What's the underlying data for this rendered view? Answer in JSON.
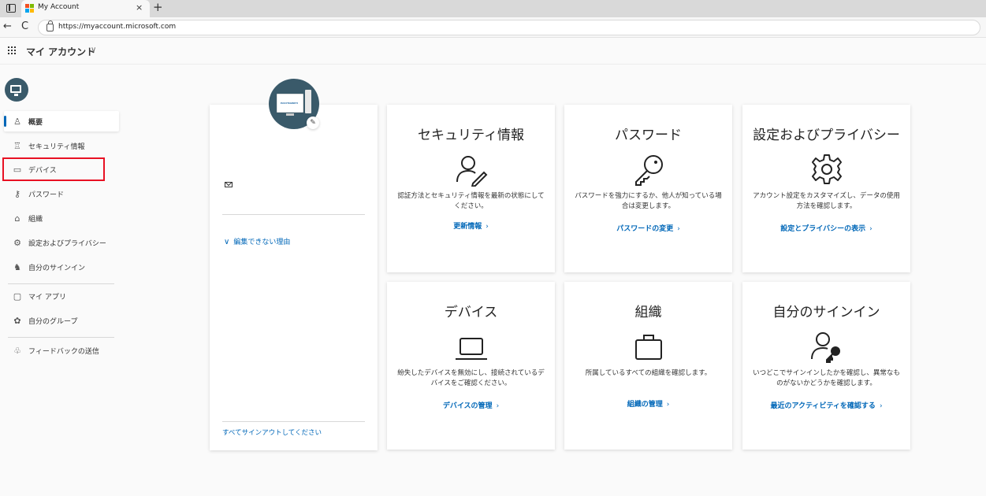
{
  "browser": {
    "tab_title": "My Account",
    "tab_close": "×",
    "new_tab": "+",
    "url": "https://myaccount.microsoft.com",
    "back": "←",
    "reload": "C"
  },
  "header": {
    "app_title": "マイ アカウント",
    "caret": "∨"
  },
  "sidebar": {
    "items": [
      {
        "label": "概要",
        "icon": "person-icon",
        "glyph": "♙"
      },
      {
        "label": "セキュリティ情報",
        "icon": "security-info-icon",
        "glyph": "♖"
      },
      {
        "label": "デバイス",
        "icon": "laptop-icon",
        "glyph": "▭"
      },
      {
        "label": "パスワード",
        "icon": "key-icon",
        "glyph": "⚷"
      },
      {
        "label": "組織",
        "icon": "briefcase-icon",
        "glyph": "⌂"
      },
      {
        "label": "設定およびプライバシー",
        "icon": "gear-icon",
        "glyph": "⚙"
      },
      {
        "label": "自分のサインイン",
        "icon": "sign-in-icon",
        "glyph": "♞"
      },
      {
        "label": "マイ アプリ",
        "icon": "apps-icon",
        "glyph": "▢"
      },
      {
        "label": "自分のグループ",
        "icon": "groups-icon",
        "glyph": "✿"
      },
      {
        "label": "フィードバックの送信",
        "icon": "feedback-icon",
        "glyph": "♧"
      }
    ],
    "active_index": 0,
    "highlighted_index": 2
  },
  "profile": {
    "edit_glyph": "✎",
    "why_link": "編集できない理由",
    "why_chevron": "∨",
    "signout_link": "すべてサインアウトしてください",
    "avatar_text": "EASYMAWPH"
  },
  "tiles": {
    "security": {
      "title": "セキュリティ情報",
      "desc": "認証方法とセキュリティ情報を最新の状態にしてください。",
      "link": "更新情報"
    },
    "password": {
      "title": "パスワード",
      "desc": "パスワードを強力にするか、他人が知っている場合は変更します。",
      "link": "パスワードの変更"
    },
    "settings": {
      "title": "設定およびプライバシー",
      "desc": "アカウント設定をカスタマイズし、データの使用方法を確認します。",
      "link": "設定とプライバシーの表示"
    },
    "devices": {
      "title": "デバイス",
      "desc": "紛失したデバイスを無効にし、接続されているデバイスをご確認ください。",
      "link": "デバイスの管理"
    },
    "organizations": {
      "title": "組織",
      "desc": "所属しているすべての組織を確認します。",
      "link": "組織の管理"
    },
    "signins": {
      "title": "自分のサインイン",
      "desc": "いつどこでサインインしたかを確認し、異常なものがないかどうかを確認します。",
      "link": "最近のアクティビティを確認する"
    },
    "chevron": "›"
  },
  "colors": {
    "accent": "#0067b8",
    "highlight_box": "#e81123",
    "avatar_bg": "#3a5a6a"
  }
}
